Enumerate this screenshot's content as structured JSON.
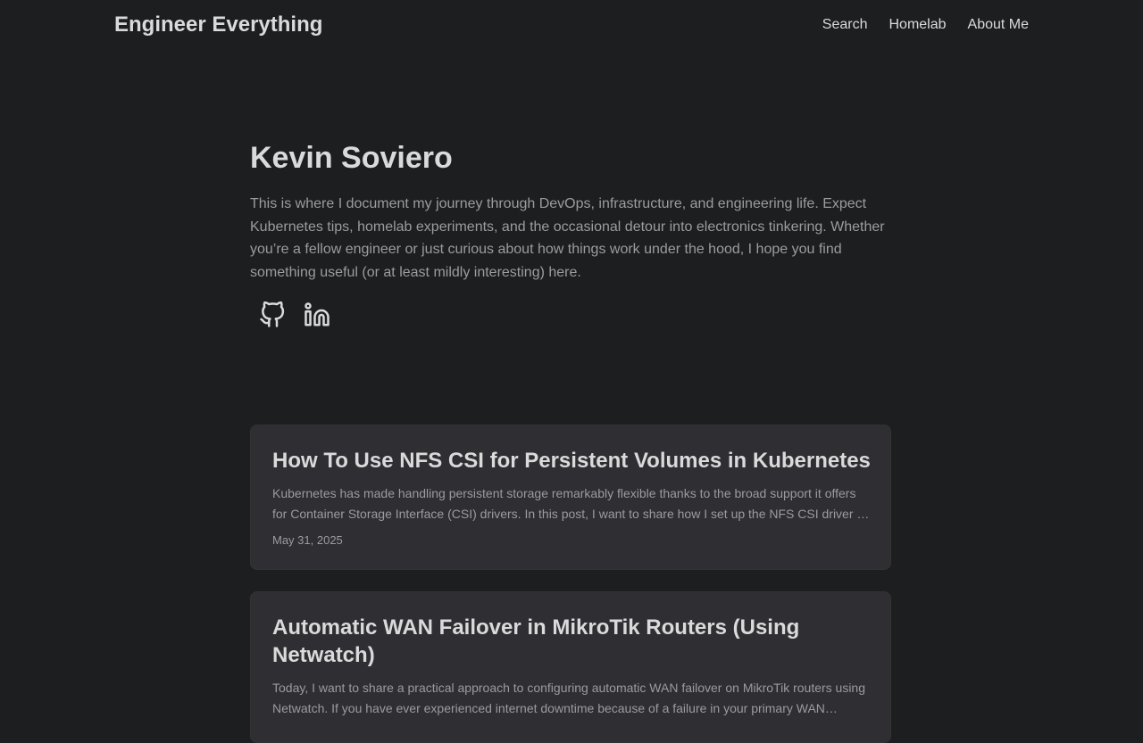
{
  "header": {
    "logo": "Engineer Everything",
    "nav": [
      {
        "label": "Search"
      },
      {
        "label": "Homelab"
      },
      {
        "label": "About Me"
      }
    ]
  },
  "profile": {
    "title": "Kevin Soviero",
    "description": "This is where I document my journey through DevOps, infrastructure, and engineering life. Expect Kubernetes tips, homelab experiments, and the occasional detour into electronics tinkering. Whether you’re a fellow engineer or just curious about how things work under the hood, I hope you find something useful (or at least mildly interesting) here.",
    "social_icons": [
      "github-icon",
      "linkedin-icon"
    ]
  },
  "posts": [
    {
      "title": "How To Use NFS CSI for Persistent Volumes in Kubernetes",
      "summary": "Kubernetes has made handling persistent storage remarkably flexible thanks to the broad support it offers for Container Storage Interface (CSI) drivers. In this post, I want to share how I set up the NFS CSI driver …",
      "date": "May 31, 2025"
    },
    {
      "title": "Automatic WAN Failover in MikroTik Routers (Using Netwatch)",
      "summary": "Today, I want to share a practical approach to configuring automatic WAN failover on MikroTik routers using Netwatch. If you have ever experienced internet downtime because of a failure in your primary WAN…"
    }
  ],
  "colors": {
    "background": "#1d1e20",
    "card": "#2e2e33",
    "primary_text": "#dadadb",
    "secondary_text": "#9b9c9d"
  }
}
